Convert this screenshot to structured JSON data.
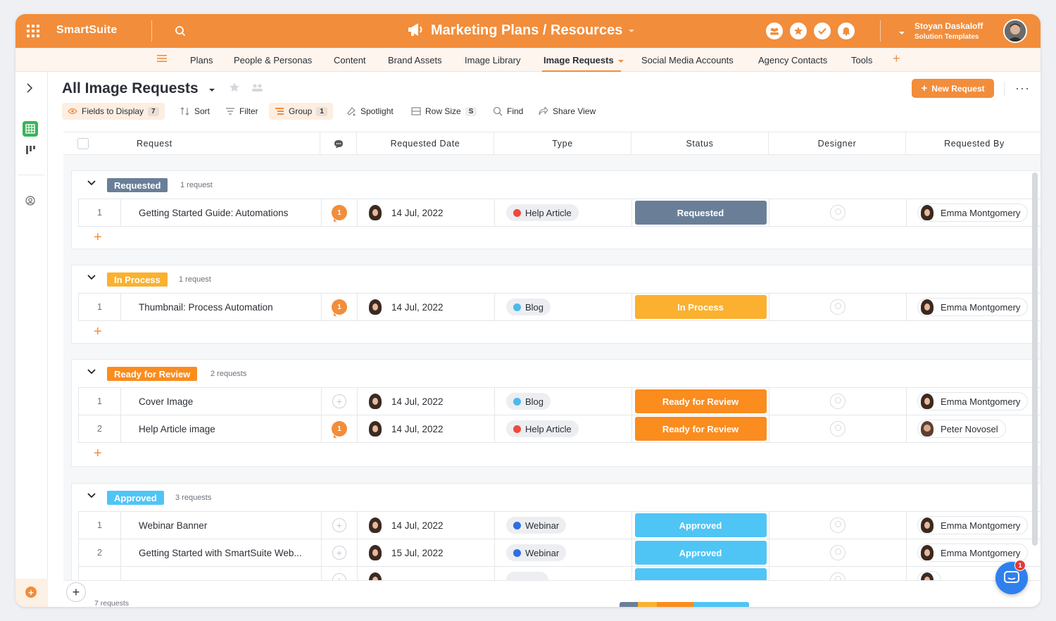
{
  "app": {
    "brand": "SmartSuite",
    "title": "Marketing Plans / Resources",
    "user_name": "Stoyan Daskaloff",
    "user_org": "Solution Templates"
  },
  "colors": {
    "accent": "#f28d3b",
    "requested": "#6a7f97",
    "in_process": "#fbb12f",
    "ready_for_review": "#fb8c1e",
    "approved": "#4fc5f5",
    "help_article_dot": "#f0483e",
    "blog_dot": "#4fb8ec",
    "webinar_dot": "#2f6fe4"
  },
  "tabs": [
    "Plans",
    "People & Personas",
    "Content",
    "Brand Assets",
    "Image Library",
    "Image Requests",
    "Social Media Accounts",
    "Agency Contacts",
    "Tools"
  ],
  "view": {
    "title": "All Image Requests",
    "new_button": "New Request",
    "toolbar": {
      "fields_label": "Fields to Display",
      "fields_count": "7",
      "sort": "Sort",
      "filter": "Filter",
      "group": "Group",
      "group_count": "1",
      "spotlight": "Spotlight",
      "row_size": "Row Size",
      "row_size_value": "S",
      "find": "Find",
      "share": "Share View"
    }
  },
  "columns": [
    "Request",
    "Requested Date",
    "Type",
    "Status",
    "Designer",
    "Requested By"
  ],
  "groups": [
    {
      "label": "Requested",
      "count": "1 request",
      "rows": [
        {
          "num": "1",
          "request": "Getting Started Guide: Automations",
          "comments": "1",
          "date": "14 Jul, 2022",
          "type": "Help Article",
          "status": "Requested",
          "requested_by": "Emma Montgomery"
        }
      ]
    },
    {
      "label": "In Process",
      "count": "1 request",
      "rows": [
        {
          "num": "1",
          "request": "Thumbnail: Process Automation",
          "comments": "1",
          "date": "14 Jul, 2022",
          "type": "Blog",
          "status": "In Process",
          "requested_by": "Emma Montgomery"
        }
      ]
    },
    {
      "label": "Ready for Review",
      "count": "2 requests",
      "rows": [
        {
          "num": "1",
          "request": "Cover Image",
          "comments": "",
          "date": "14 Jul, 2022",
          "type": "Blog",
          "status": "Ready for Review",
          "requested_by": "Emma Montgomery"
        },
        {
          "num": "2",
          "request": "Help Article image",
          "comments": "1",
          "date": "14 Jul, 2022",
          "type": "Help Article",
          "status": "Ready for Review",
          "requested_by": "Peter Novosel"
        }
      ]
    },
    {
      "label": "Approved",
      "count": "3 requests",
      "rows": [
        {
          "num": "1",
          "request": "Webinar Banner",
          "comments": "",
          "date": "14 Jul, 2022",
          "type": "Webinar",
          "status": "Approved",
          "requested_by": "Emma Montgomery"
        },
        {
          "num": "2",
          "request": "Getting Started with SmartSuite Web...",
          "comments": "",
          "date": "15 Jul, 2022",
          "type": "Webinar",
          "status": "Approved",
          "requested_by": "Emma Montgomery"
        }
      ]
    }
  ],
  "footer": {
    "total": "7 requests",
    "chat_notifications": "1"
  }
}
